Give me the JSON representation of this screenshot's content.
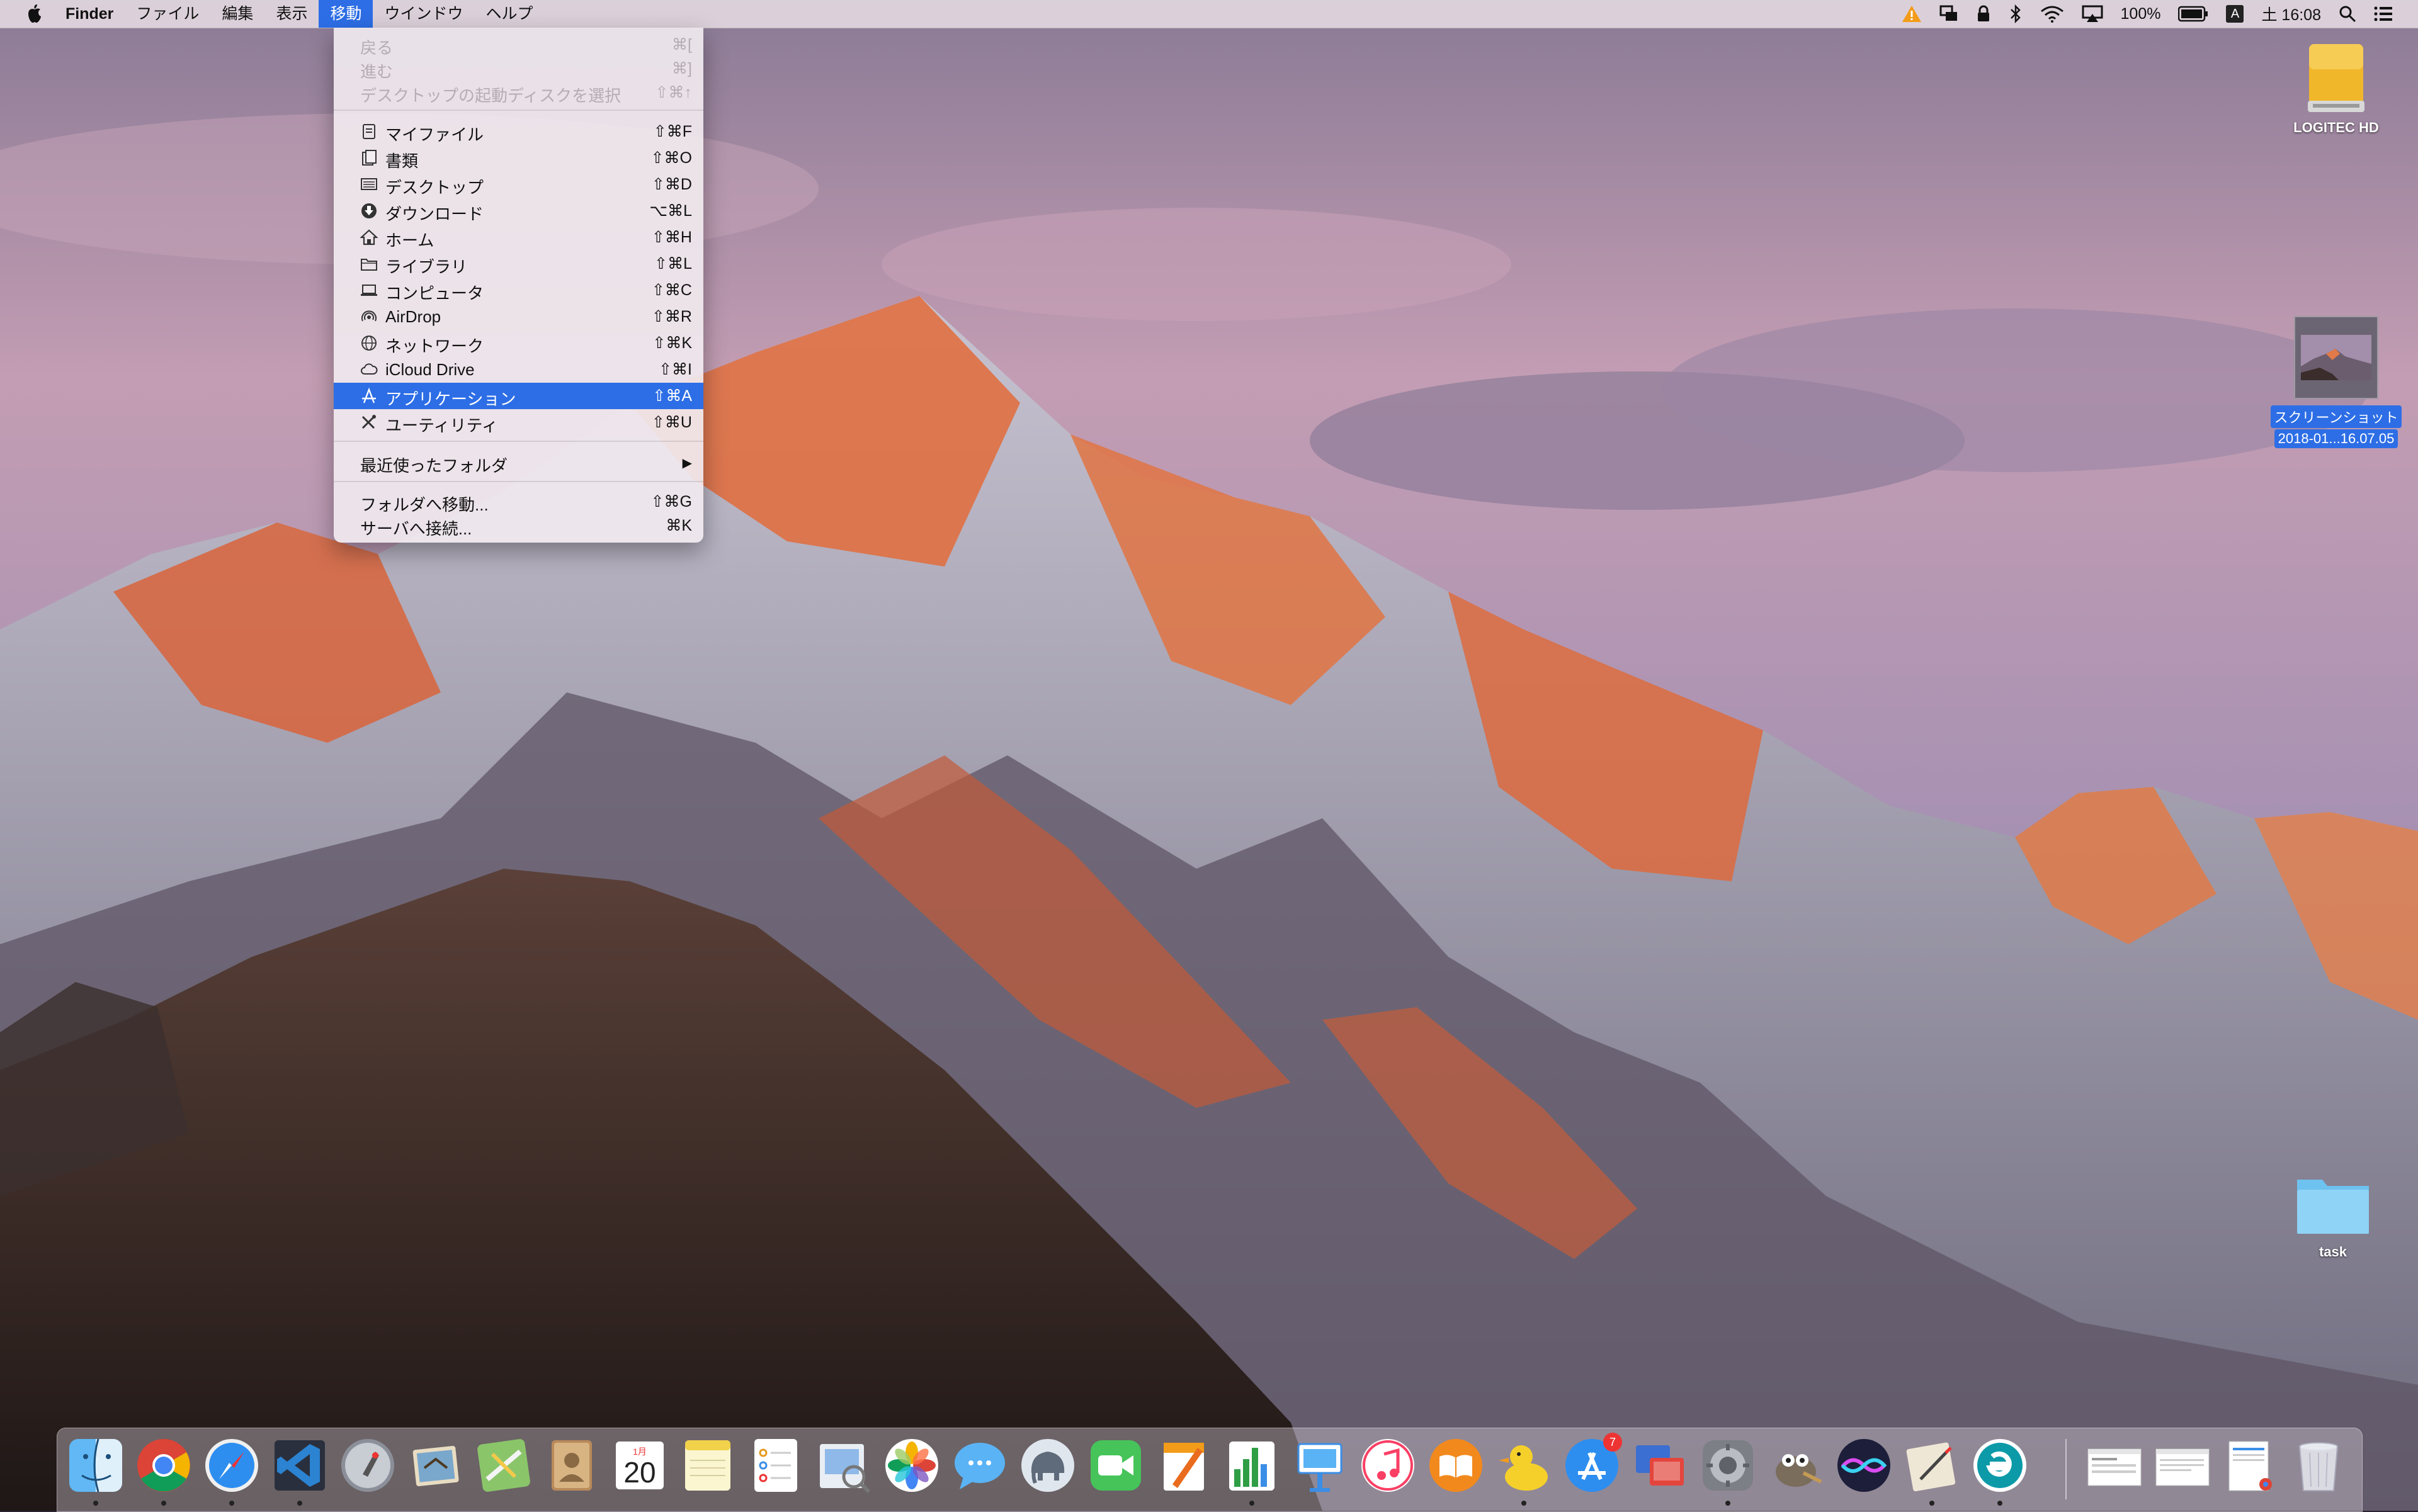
{
  "menubar": {
    "apple_icon": "apple-icon",
    "items": [
      "Finder",
      "ファイル",
      "編集",
      "表示",
      "移動",
      "ウインドウ",
      "ヘルプ"
    ],
    "active_index": 4,
    "status": {
      "battery": "100%",
      "input_source": "A",
      "clock": "土 16:08",
      "icons": [
        "warning-icon",
        "display-mirror-icon",
        "lock-icon",
        "bluetooth-icon",
        "wifi-icon",
        "airplay-icon",
        "battery-icon",
        "input-source-icon",
        "spotlight-icon",
        "notification-center-icon"
      ]
    }
  },
  "go_menu": {
    "items": [
      {
        "label": "戻る",
        "shortcut": "⌘[",
        "disabled": true
      },
      {
        "label": "進む",
        "shortcut": "⌘]",
        "disabled": true
      },
      {
        "label": "デスクトップの起動ディスクを選択",
        "shortcut": "⇧⌘↑",
        "disabled": true
      },
      {
        "label": "マイファイル",
        "shortcut": "⇧⌘F",
        "icon": "all-my-files-icon"
      },
      {
        "label": "書類",
        "shortcut": "⇧⌘O",
        "icon": "documents-icon"
      },
      {
        "label": "デスクトップ",
        "shortcut": "⇧⌘D",
        "icon": "desktop-icon"
      },
      {
        "label": "ダウンロード",
        "shortcut": "⌥⌘L",
        "icon": "downloads-icon"
      },
      {
        "label": "ホーム",
        "shortcut": "⇧⌘H",
        "icon": "home-icon"
      },
      {
        "label": "ライブラリ",
        "shortcut": "⇧⌘L",
        "icon": "library-icon"
      },
      {
        "label": "コンピュータ",
        "shortcut": "⇧⌘C",
        "icon": "computer-icon"
      },
      {
        "label": "AirDrop",
        "shortcut": "⇧⌘R",
        "icon": "airdrop-icon"
      },
      {
        "label": "ネットワーク",
        "shortcut": "⇧⌘K",
        "icon": "network-icon"
      },
      {
        "label": "iCloud Drive",
        "shortcut": "⇧⌘I",
        "icon": "icloud-icon"
      },
      {
        "label": "アプリケーション",
        "shortcut": "⇧⌘A",
        "icon": "applications-icon",
        "selected": true
      },
      {
        "label": "ユーティリティ",
        "shortcut": "⇧⌘U",
        "icon": "utilities-icon"
      },
      {
        "label": "最近使ったフォルダ",
        "submenu_arrow": "▶"
      },
      {
        "label": "フォルダへ移動...",
        "shortcut": "⇧⌘G"
      },
      {
        "label": "サーバへ接続...",
        "shortcut": "⌘K"
      }
    ]
  },
  "desktop": {
    "icons": [
      {
        "name": "LOGITEC HD",
        "kind": "external-drive-icon"
      },
      {
        "name_line1": "スクリーンショット",
        "name_line2": "2018-01...16.07.05",
        "kind": "screenshot-thumbnail",
        "selected": true
      },
      {
        "name": "task",
        "kind": "folder-icon"
      }
    ]
  },
  "dock": {
    "apps": [
      {
        "name": "Finder",
        "icon": "finder-icon",
        "running": true
      },
      {
        "name": "Google Chrome",
        "icon": "chrome-icon",
        "running": true
      },
      {
        "name": "Safari",
        "icon": "safari-icon",
        "running": true
      },
      {
        "name": "Visual Studio Code",
        "icon": "vscode-icon",
        "running": true
      },
      {
        "name": "Launchpad",
        "icon": "launchpad-icon"
      },
      {
        "name": "Mail",
        "icon": "mail-icon"
      },
      {
        "name": "Maps",
        "icon": "maps-icon"
      },
      {
        "name": "Contacts",
        "icon": "contacts-icon"
      },
      {
        "name": "Calendar",
        "icon": "calendar-icon",
        "badge_text": "20",
        "month_text": "1月"
      },
      {
        "name": "Notes",
        "icon": "notes-icon"
      },
      {
        "name": "Reminders",
        "icon": "reminders-icon"
      },
      {
        "name": "Preview",
        "icon": "preview-icon"
      },
      {
        "name": "Photos",
        "icon": "photos-icon"
      },
      {
        "name": "Messages",
        "icon": "messages-icon"
      },
      {
        "name": "Sequel Pro",
        "icon": "elephant-icon"
      },
      {
        "name": "FaceTime",
        "icon": "facetime-icon"
      },
      {
        "name": "Pages",
        "icon": "pages-icon"
      },
      {
        "name": "Numbers",
        "icon": "numbers-icon",
        "running": true
      },
      {
        "name": "Keynote",
        "icon": "keynote-icon"
      },
      {
        "name": "iTunes",
        "icon": "itunes-icon"
      },
      {
        "name": "iBooks",
        "icon": "ibooks-icon"
      },
      {
        "name": "Cyberduck",
        "icon": "duck-icon",
        "running": true
      },
      {
        "name": "App Store",
        "icon": "appstore-icon",
        "badge": "7"
      },
      {
        "name": "Microsoft Remote Desktop",
        "icon": "remote-desktop-icon"
      },
      {
        "name": "System Preferences",
        "icon": "system-preferences-icon",
        "running": true
      },
      {
        "name": "GIMP",
        "icon": "gimp-icon"
      },
      {
        "name": "Siri",
        "icon": "siri-icon"
      },
      {
        "name": "Script Editor",
        "icon": "script-editor-icon",
        "running": true
      },
      {
        "name": "ESET",
        "icon": "eset-icon",
        "running": true
      },
      {
        "name": "Window 1",
        "icon": "window-thumbnail-icon"
      },
      {
        "name": "Window 2",
        "icon": "window-thumbnail-icon"
      },
      {
        "name": "Chrome window",
        "icon": "window-thumbnail-icon"
      },
      {
        "name": "Trash",
        "icon": "trash-icon"
      }
    ]
  }
}
